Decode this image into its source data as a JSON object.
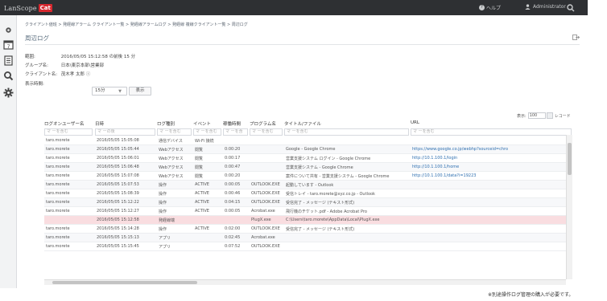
{
  "app": {
    "brand": "LanScope",
    "brand_badge": "Cat"
  },
  "topbar": {
    "help_label": "ヘルプ",
    "user_label": "Administrator"
  },
  "breadcrumb": "クライアント値班 > 発経線アラーム クライアント一覧 > 発経線アラームログ > 発経線 複線クライアント一覧 > 周辺ログ",
  "page_title": "周辺ログ",
  "info": {
    "period_key": "範囲:",
    "period_val": "2016/05/05 15:12:58 の前後 15 分",
    "group_key": "グループ名:",
    "group_val": "日本\\東京本部\\営業部",
    "client_key": "クライアント名:",
    "client_val": "茂木孝 太郎 ⓘ",
    "interval_key": "表示時間:",
    "interval_val": "15分",
    "show_button": "表示"
  },
  "pager": {
    "label_prefix": "表示:",
    "count": "100",
    "label_suffix": "レコード"
  },
  "columns": [
    {
      "header": "ログオンユーザー名",
      "filter": "マ ーを含む"
    },
    {
      "header": "日時",
      "filter": "マ ーの後"
    },
    {
      "header": "ログ種別",
      "filter": "マ ーを含む"
    },
    {
      "header": "イベント",
      "filter": "マ ーを含む"
    },
    {
      "header": "稼働時間",
      "filter": "マ ーを含"
    },
    {
      "header": "プログラム名",
      "filter": "マ ーを含む"
    },
    {
      "header": "タイトル/ファイル",
      "filter": "マ ーを含む"
    },
    {
      "header": "URL",
      "filter": "マ ーを含む"
    }
  ],
  "rows": [
    [
      "taro.morete",
      "2016/05/05 15:05:08",
      "通信デバイス",
      "Wi-Fi 接続",
      "",
      "",
      "",
      ""
    ],
    [
      "taro.morete",
      "2016/05/05 15:05:44",
      "Webアクセス",
      "閲覧",
      "0:00:20",
      "",
      "Google - Google Chrome",
      "https://www.google.co.jp/webhp?sourceid=chro"
    ],
    [
      "taro.morete",
      "2016/05/05 15:06:01",
      "Webアクセス",
      "閲覧",
      "0:00:17",
      "",
      "営業支援システム ログイン - Google Chrome",
      "http://10.1.100.1/login"
    ],
    [
      "taro.morete",
      "2016/05/05 15:06:48",
      "Webアクセス",
      "閲覧",
      "0:00:47",
      "",
      "営業支援システム - Google Chrome",
      "http://10.1.100.1/home"
    ],
    [
      "taro.morete",
      "2016/05/05 15:07:08",
      "Webアクセス",
      "閲覧",
      "0:00:20",
      "",
      "案件について共有 - 営業支援システム - Google Chrome",
      "http://10.1.100.1/data?i=19223"
    ],
    [
      "taro.morete",
      "2016/05/05 15:07:53",
      "操作",
      "ACTIVE",
      "0:00:05",
      "OUTLOOK.EXE",
      "起動しています - Outlook",
      ""
    ],
    [
      "taro.morete",
      "2016/05/05 15:08:39",
      "操作",
      "ACTIVE",
      "0:00:46",
      "OUTLOOK.EXE",
      "受信トレイ - taro.morete@xyz.co.jp - Outlook",
      ""
    ],
    [
      "taro.morete",
      "2016/05/05 15:12:22",
      "操作",
      "ACTIVE",
      "0:04:15",
      "OUTLOOK.EXE",
      "受信完了 - メッセージ (テキスト形式)",
      ""
    ],
    [
      "taro.morete",
      "2016/05/05 15:12:27",
      "操作",
      "ACTIVE",
      "0:00:05",
      "Acrobat.exe",
      "飛行機のチケット.pdf - Adobe Acrobat Pro",
      ""
    ],
    [
      "",
      "2016/05/05 15:12:58",
      "発経線端",
      "",
      "",
      "PlugX.exe",
      "C:\\Users\\taro.morete\\AppData\\Local\\PlugX.exe",
      ""
    ],
    [
      "taro.morete",
      "2016/05/05 15:14:28",
      "操作",
      "ACTIVE",
      "0:02:00",
      "OUTLOOK.EXE",
      "受信完了 - メッセージ (テキスト形式)",
      ""
    ],
    [
      "taro.morete",
      "2016/05/05 15:15:13",
      "アプリ",
      "",
      "0:02:45",
      "Acrobat.exe",
      "",
      ""
    ],
    [
      "taro.morete",
      "2016/05/05 15:15:45",
      "アプリ",
      "",
      "0:07:52",
      "OUTLOOK.EXE",
      "",
      ""
    ]
  ],
  "highlight_row": 9,
  "footnote": "※別途操作ログ管理の購入が必要です。",
  "colors": {
    "topbar": "#2e3033",
    "brand_badge": "#d7282f",
    "highlight": "#f9dde0",
    "link": "#2e6fb0"
  },
  "icons": [
    "gear-icon",
    "calendar-icon",
    "list-icon",
    "search-icon",
    "settings-icon",
    "export-icon",
    "help-icon",
    "user-icon",
    "magnifier-icon"
  ]
}
